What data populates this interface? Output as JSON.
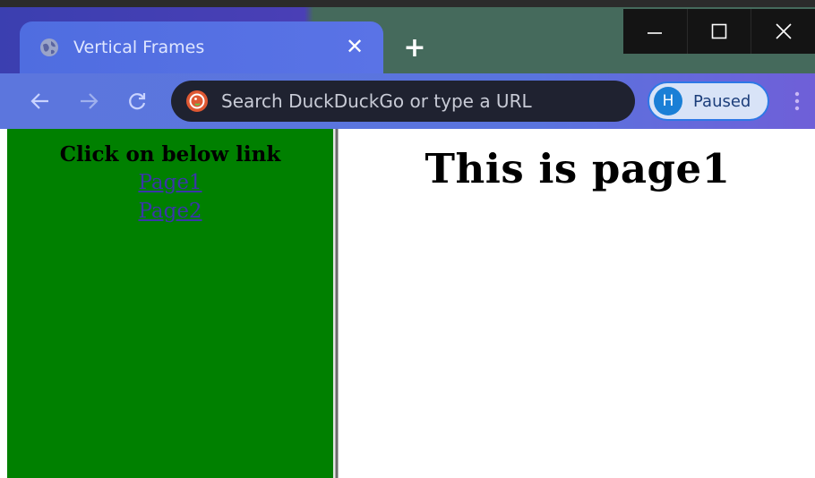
{
  "browser": {
    "tab": {
      "title": "Vertical Frames",
      "favicon": "globe-icon",
      "close_glyph": "✕"
    },
    "new_tab_glyph": "+",
    "window_controls": {
      "minimize": "minimize-icon",
      "maximize": "maximize-icon",
      "close": "close-icon"
    },
    "toolbar": {
      "back": "back-arrow-icon",
      "forward": "forward-arrow-icon",
      "reload": "reload-icon",
      "search_engine_icon": "duckduckgo-icon",
      "omnibox_placeholder": "Search DuckDuckGo or type a URL",
      "profile": {
        "initial": "H",
        "label": "Paused"
      },
      "menu": "kebab-menu-icon"
    },
    "colors": {
      "tab_active": "#4f6de0",
      "toolbar": "#5c76dd",
      "omnibox": "#1f2230",
      "profile_pill": "#d8e3f7",
      "avatar": "#1a7fd6"
    }
  },
  "page": {
    "left_frame": {
      "background": "#008000",
      "heading": "Click on below link",
      "links": [
        {
          "label": "Page1"
        },
        {
          "label": "Page2"
        }
      ]
    },
    "right_frame": {
      "heading": "This is page1"
    }
  }
}
